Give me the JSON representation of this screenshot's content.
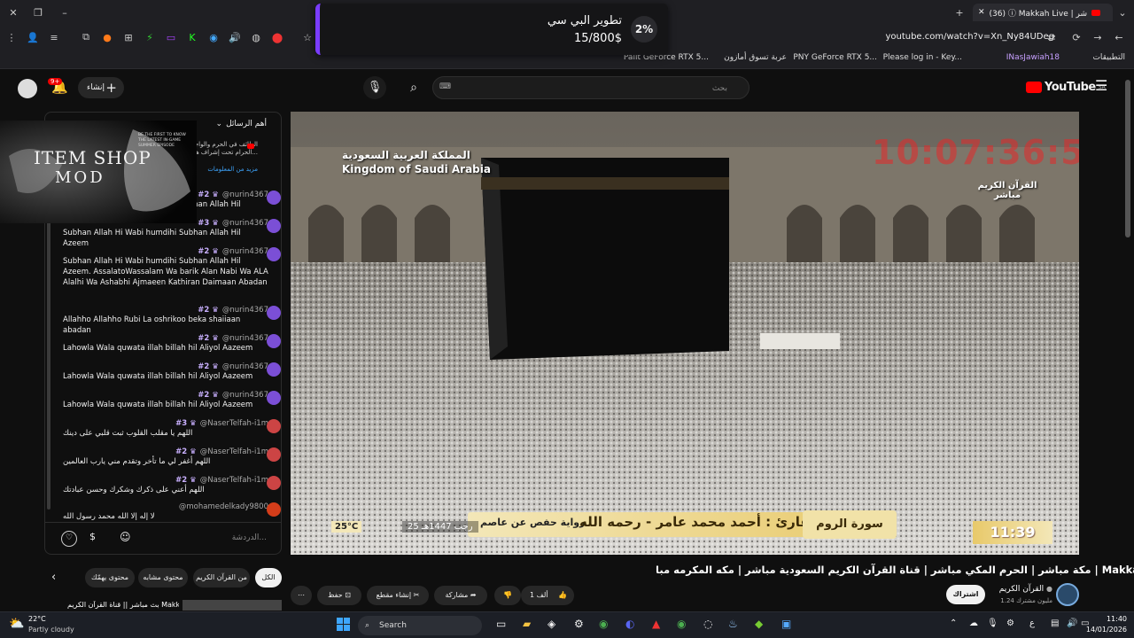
{
  "browser": {
    "tab_title": "(36) ⓘ Makkah Live | مكة مباشر",
    "tab_badge": "36",
    "url": "youtube.com/watch?v=Xn_Ny84UDeg",
    "bookmarks": [
      "التطبيقات",
      "INasJawiah18",
      "Please log in - Key...",
      "PNY GeForce RTX 5...",
      "عربة تسوق أمازون",
      "Palit GeForce RTX 5..."
    ]
  },
  "overlay": {
    "title": "تطوير البي سي",
    "amount": "15/800$",
    "percent_label": "2%",
    "accent": "#7a3cff"
  },
  "youtube": {
    "logo": "YouTube",
    "country": "SA",
    "search_placeholder": "بحث",
    "create_label": "إنشاء",
    "notif_count": "9+"
  },
  "chat": {
    "header": "أهم الرسائل",
    "pinned_text": "الطائف في الحرم والواجب المسجد الحرام تحت إشراف هيئة...",
    "pinned_more": "مزيد من المعلومات",
    "input_placeholder": "الدردشة...",
    "messages": [
      {
        "author": "@nurin4367",
        "badge": "#2",
        "text": "Subhan Allah Hi Wabi humdihi Subhan Allah Hil Azeem",
        "avatar": "#7b4fd6"
      },
      {
        "author": "@nurin4367",
        "badge": "#3",
        "text": "Subhan Allah Hi Wabi humdihi Subhan Allah Hil Azeem",
        "avatar": "#7b4fd6"
      },
      {
        "author": "@nurin4367",
        "badge": "#2",
        "text": "Subhan Allah Hi Wabi humdihi Subhan Allah Hil Azeem. AssalatoWassalam Wa barik Alan Nabi Wa ALA Alalhi Wa Ashabhi Ajmaeen Kathiran Daimaan Abadan",
        "avatar": "#7b4fd6"
      },
      {
        "author": "@nurin4367",
        "badge": "#2",
        "text": "Allahho Allahho Rubi La oshrikoo beka shaiiaan abadan",
        "avatar": "#7b4fd6"
      },
      {
        "author": "@nurin4367",
        "badge": "#2",
        "text": "Lahowla Wala quwata illah billah hil Aliyol Aazeem",
        "avatar": "#7b4fd6"
      },
      {
        "author": "@nurin4367",
        "badge": "#2",
        "text": "Lahowla Wala quwata illah billah hil Aliyol Aazeem",
        "avatar": "#7b4fd6"
      },
      {
        "author": "@nurin4367",
        "badge": "#2",
        "text": "Lahowla Wala quwata illah billah hil Aliyol Aazeem",
        "avatar": "#7b4fd6"
      },
      {
        "author": "@NaserTelfah-i1m",
        "badge": "#3",
        "text": "اللهم يا مقلب القلوب ثبت قلبي على دينك",
        "avatar": "#c44"
      },
      {
        "author": "@NaserTelfah-i1m",
        "badge": "#2",
        "text": "اللهم أغفر لي ما تأخر وتقدم مني يارب العالمين",
        "avatar": "#c44"
      },
      {
        "author": "@NaserTelfah-i1m",
        "badge": "#2",
        "text": "اللهم أعني على ذكرك وشكرك وحسن عبادتك",
        "avatar": "#c44"
      },
      {
        "author": "@mohamedelkady9800",
        "badge": "",
        "text": "لا إله إلا الله محمد رسول الله",
        "avatar": "#d43d1a"
      }
    ]
  },
  "promo": {
    "title_line1": "ITEM SHOP",
    "title_line2": "MOD",
    "tagline": "BE THE FIRST TO KNOW THE LATEST IN-GAME SUMMER EPISODE"
  },
  "video": {
    "country_ar": "المملكة العربية السعودية",
    "country_en": "Kingdom of Saudi Arabia",
    "clock": "10:07:36:57",
    "channel_mark_line1": "القرآن الكريم",
    "channel_mark_line2": "مباشر",
    "surah": "سورة الروم",
    "reader": "القارئ : أحمد محمد عامر - رحمه الله",
    "riwaya": "رواية حفص عن عاصم",
    "hijri_date": "25 رجب 1447هـ",
    "temp": "25°C",
    "time": "11:39"
  },
  "below": {
    "title": "مكة مباشر | الحرم المكي مباشر | قناة القرآن الكريم السعودية مباشر | مكه المكرمه مبا | Makkah Live 🕋",
    "channel": "القرآن الكريم",
    "subscribers": "1.24 مليون مشترك",
    "subscribe": "اشتراك",
    "likes": "1 ألف",
    "share": "مشاركة",
    "clip": "إنشاء مقطع",
    "save": "حفظ",
    "chips": [
      "الكل",
      "من القرآن الكريم",
      "محتوى مشابه",
      "محتوى يهمّك"
    ],
    "next_video": "بث مباشر || قناة القرآن الكريم Makkah"
  },
  "taskbar": {
    "weather_temp": "22°C",
    "weather_desc": "Partly cloudy",
    "search": "Search",
    "time": "11:40",
    "date": "14/01/2026",
    "lang": "ع"
  }
}
